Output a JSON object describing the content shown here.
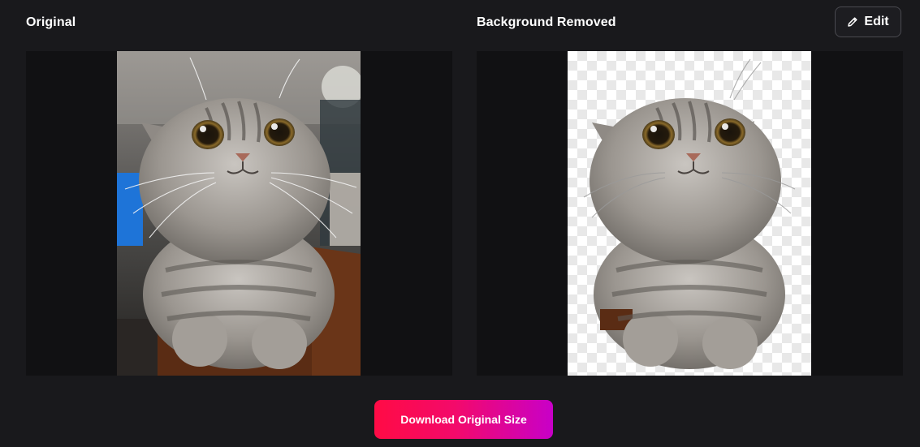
{
  "panels": {
    "original_title": "Original",
    "removed_title": "Background Removed"
  },
  "toolbar": {
    "edit_label": "Edit",
    "edit_icon": "pencil-icon"
  },
  "actions": {
    "download_label": "Download Original Size"
  },
  "colors": {
    "background": "#19191c",
    "frame": "#111113",
    "accent_start": "#ff0b45",
    "accent_end": "#c800c8"
  }
}
